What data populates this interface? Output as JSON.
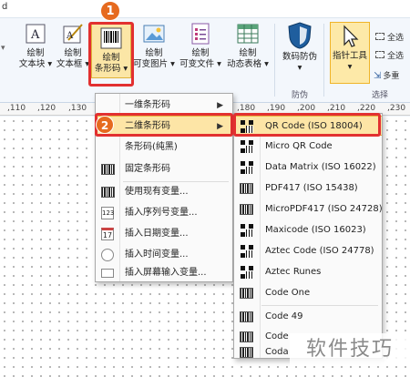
{
  "window": {
    "title_fragment": "d"
  },
  "ribbon": {
    "buttons": [
      {
        "id": "text-block",
        "label1": "绘制",
        "label2": "文本块 ▾"
      },
      {
        "id": "text-box",
        "label1": "绘制",
        "label2": "文本框 ▾"
      },
      {
        "id": "barcode",
        "label1": "绘制",
        "label2": "条形码 ▾"
      },
      {
        "id": "var-image",
        "label1": "绘制",
        "label2": "可变图片 ▾"
      },
      {
        "id": "var-file",
        "label1": "绘制",
        "label2": "可变文件 ▾"
      },
      {
        "id": "dyn-table",
        "label1": "绘制",
        "label2": "动态表格 ▾"
      },
      {
        "id": "anti-fake",
        "label1": "数码防伪",
        "label2": "▾"
      },
      {
        "id": "pointer-tool",
        "label1": "指针工具",
        "label2": "▾"
      }
    ],
    "group_labels": {
      "anti_fake": "防伪",
      "select": "选择"
    },
    "small_buttons": [
      "全选",
      "全选",
      "多重"
    ]
  },
  "ruler": {
    "ticks_left": [
      ",110",
      ",120",
      ",130"
    ],
    "ticks_right": [
      ",180",
      ",190",
      ",200",
      ",210",
      ",220",
      ",230"
    ]
  },
  "badges": [
    "1",
    "2"
  ],
  "barcode_menu": {
    "items": [
      {
        "label": "一维条形码",
        "submenu": true
      },
      {
        "label": "二维条形码",
        "submenu": true,
        "active": true
      },
      {
        "label": "条形码(纯黑)",
        "submenu": false
      },
      {
        "label": "固定条形码",
        "submenu": false
      },
      {
        "label": "使用现有变量...",
        "submenu": false
      },
      {
        "label": "插入序列号变量...",
        "submenu": false
      },
      {
        "label": "插入日期变量...",
        "submenu": false
      },
      {
        "label": "插入时间变量...",
        "submenu": false
      },
      {
        "label": "插入屏幕输入变量...",
        "submenu": false
      }
    ]
  },
  "qr_submenu": {
    "items": [
      "QR Code (ISO 18004)",
      "Micro QR Code",
      "Data Matrix (ISO 16022)",
      "PDF417 (ISO 15438)",
      "MicroPDF417 (ISO 24728)",
      "Maxicode (ISO 16023)",
      "Aztec Code (ISO 24778)",
      "Aztec Runes",
      "Code One",
      "Code 49",
      "Code",
      "Coda"
    ]
  },
  "watermark": "软件技巧"
}
